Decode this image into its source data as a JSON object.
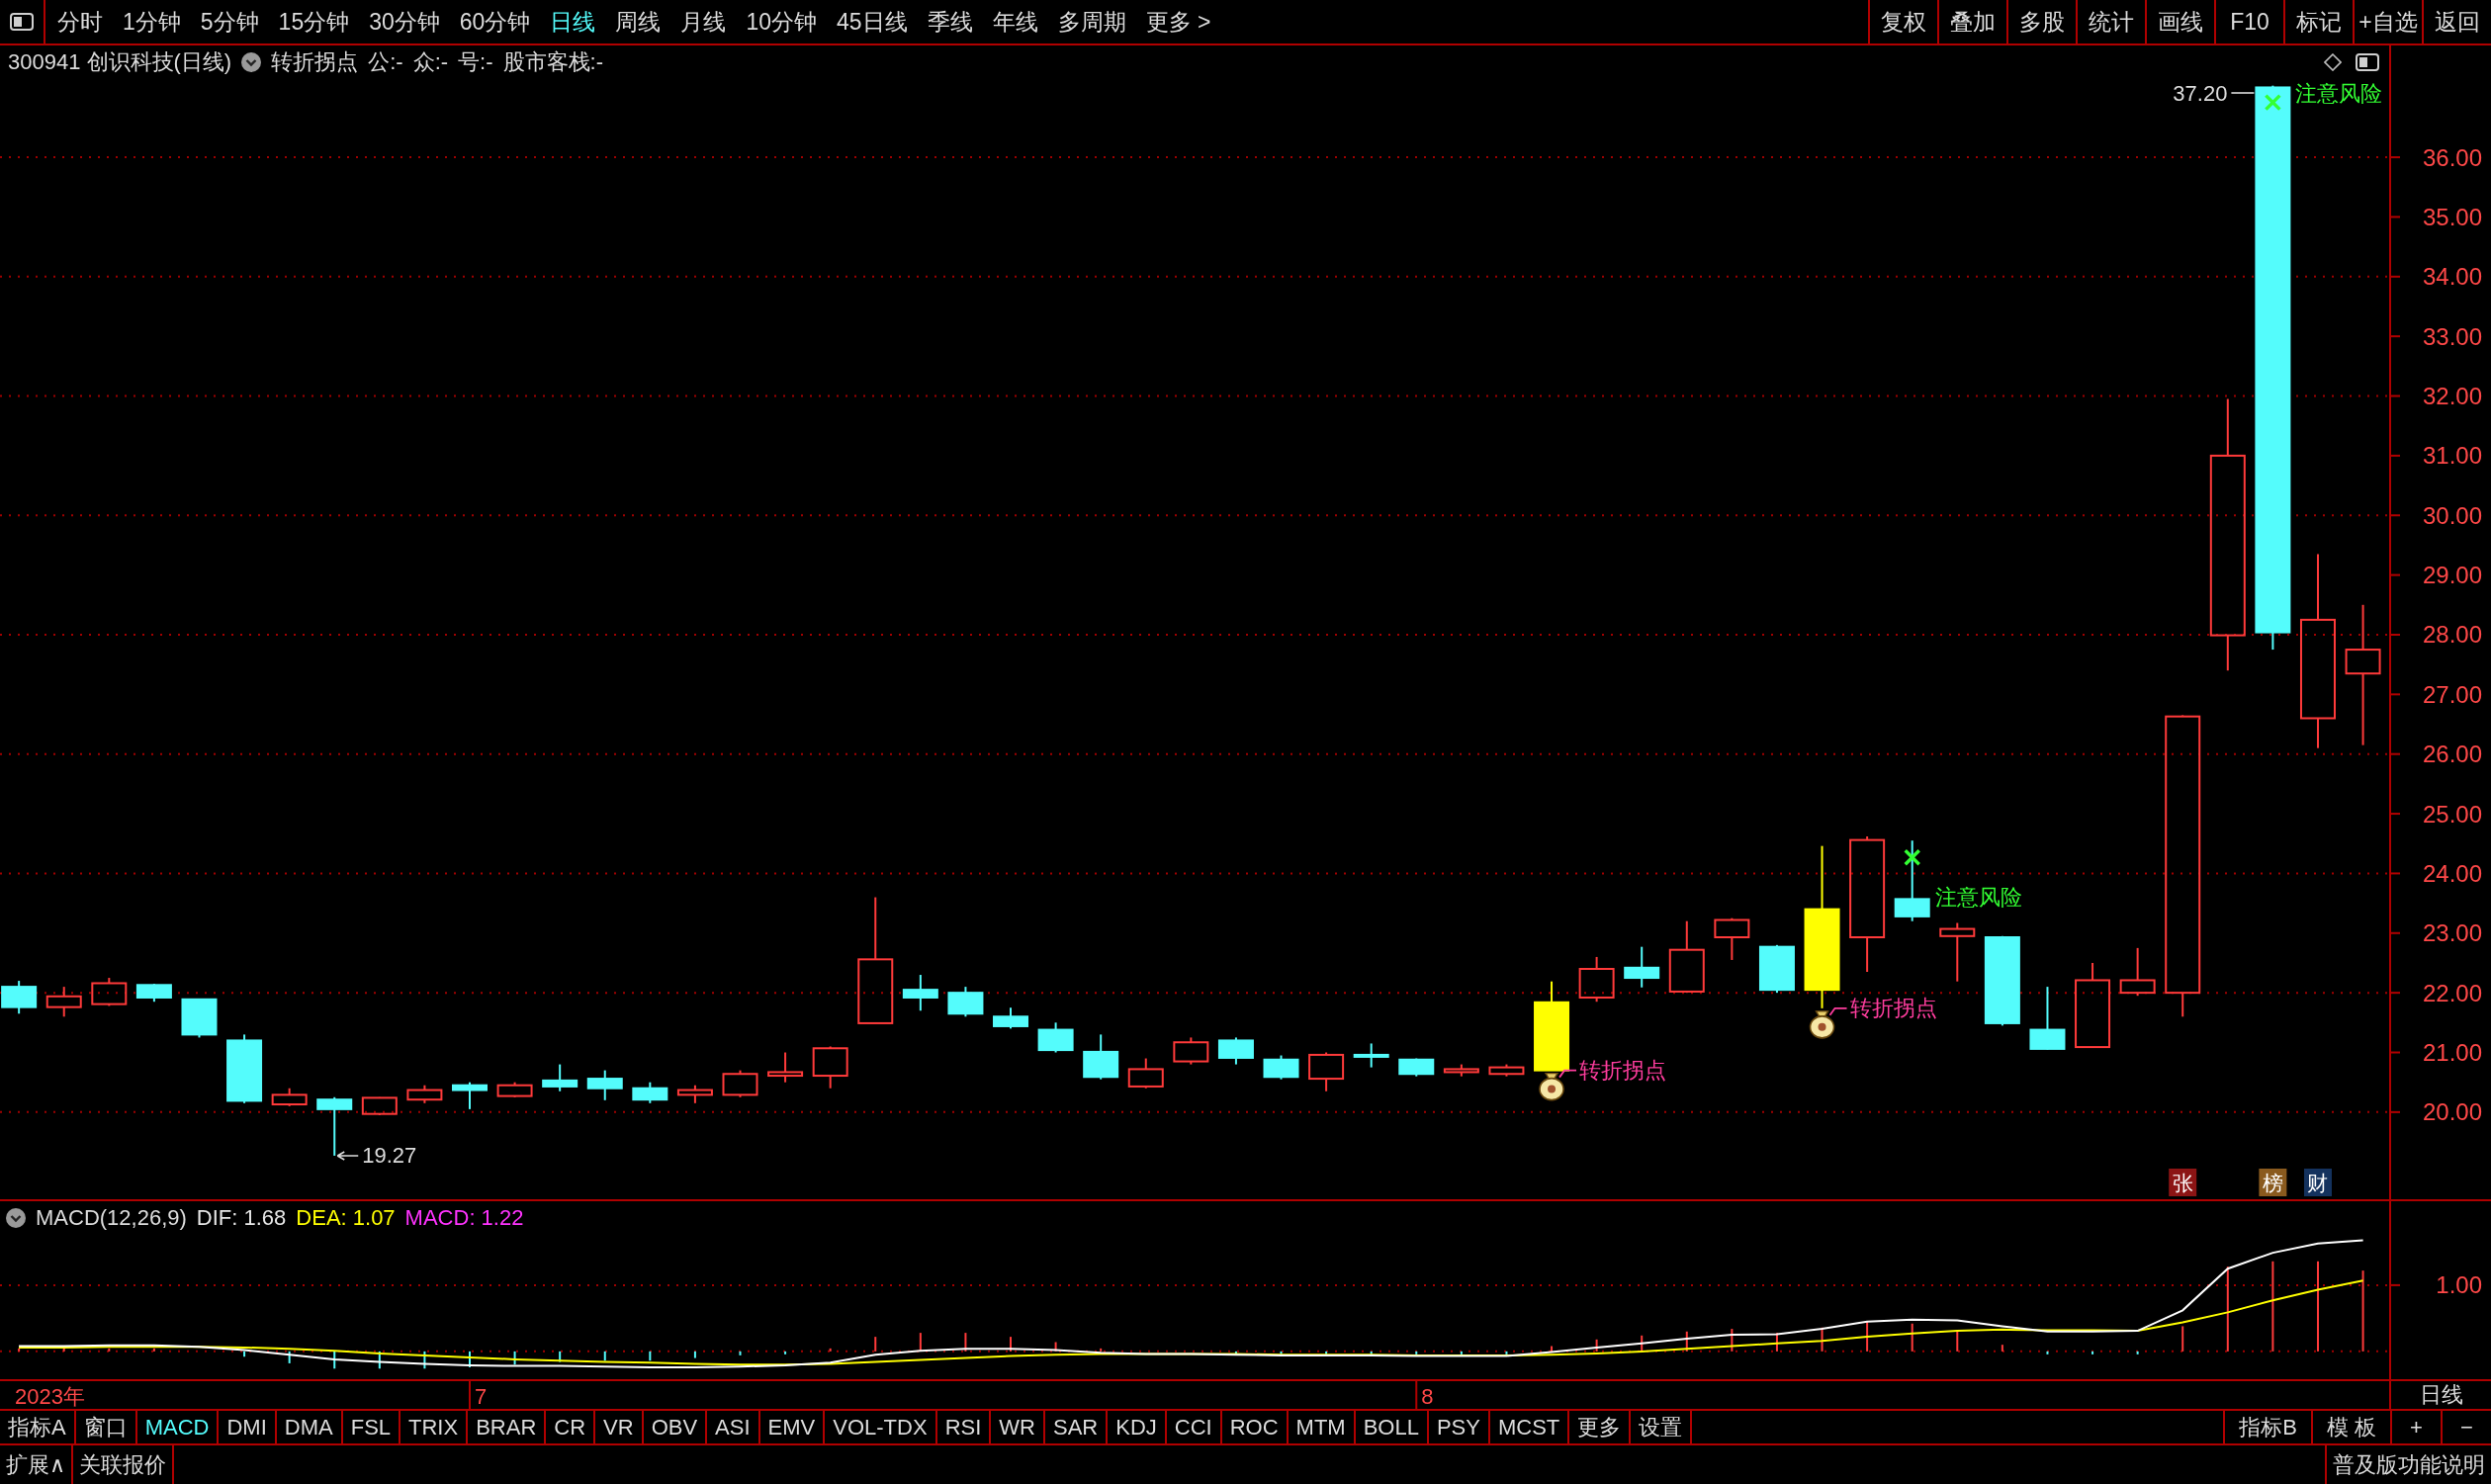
{
  "toolbar": {
    "periods": [
      {
        "label": "分时",
        "selected": false
      },
      {
        "label": "1分钟",
        "selected": false
      },
      {
        "label": "5分钟",
        "selected": false
      },
      {
        "label": "15分钟",
        "selected": false
      },
      {
        "label": "30分钟",
        "selected": false
      },
      {
        "label": "60分钟",
        "selected": false
      },
      {
        "label": "日线",
        "selected": true
      },
      {
        "label": "周线",
        "selected": false
      },
      {
        "label": "月线",
        "selected": false
      },
      {
        "label": "10分钟",
        "selected": false
      },
      {
        "label": "45日线",
        "selected": false
      },
      {
        "label": "季线",
        "selected": false
      },
      {
        "label": "年线",
        "selected": false
      },
      {
        "label": "多周期",
        "selected": false
      },
      {
        "label": "更多 >",
        "selected": false
      }
    ],
    "buttons": [
      "复权",
      "叠加",
      "多股",
      "统计",
      "画线",
      "F10",
      "标记",
      "+自选",
      "返回"
    ]
  },
  "chart_header": {
    "security": "300941 创识科技(日线)",
    "indicator": "转折拐点",
    "outputs": [
      "公:-",
      "众:-",
      "号:-",
      "股市客栈:-"
    ]
  },
  "price_chart": {
    "high_label": "37.20",
    "axis_labels": [
      "36.00",
      "35.00",
      "34.00",
      "33.00",
      "32.00",
      "31.00",
      "30.00",
      "29.00",
      "28.00",
      "27.00",
      "26.00",
      "25.00",
      "24.00",
      "23.00",
      "22.00",
      "21.00",
      "20.00"
    ],
    "warnings": [
      "注意风险",
      "注意风险"
    ],
    "signals": [
      "转折拐点",
      "转折拐点"
    ],
    "low_label": "19.27",
    "tags": [
      {
        "label": "张",
        "color": "#8c1414"
      },
      {
        "label": "榜",
        "color": "#8a5a1e"
      },
      {
        "label": "财",
        "color": "#14325e"
      }
    ]
  },
  "macd_panel": {
    "title": "MACD(12,26,9)",
    "readings": [
      {
        "text": "DIF: 1.68",
        "color": "#e6e6e6"
      },
      {
        "text": "DEA: 1.07",
        "color": "#ffff00"
      },
      {
        "text": "MACD: 1.22",
        "color": "#ff33ff"
      }
    ],
    "axis_label": "1.00"
  },
  "date_labels": [
    "2023年",
    "7",
    "8"
  ],
  "period_label": "日线",
  "indicator_tabs": [
    {
      "label": "指标A",
      "selected": false
    },
    {
      "label": "窗口",
      "selected": false
    },
    {
      "label": "MACD",
      "selected": true
    },
    {
      "label": "DMI",
      "selected": false
    },
    {
      "label": "DMA",
      "selected": false
    },
    {
      "label": "FSL",
      "selected": false
    },
    {
      "label": "TRIX",
      "selected": false
    },
    {
      "label": "BRAR",
      "selected": false
    },
    {
      "label": "CR",
      "selected": false
    },
    {
      "label": "VR",
      "selected": false
    },
    {
      "label": "OBV",
      "selected": false
    },
    {
      "label": "ASI",
      "selected": false
    },
    {
      "label": "EMV",
      "selected": false
    },
    {
      "label": "VOL-TDX",
      "selected": false
    },
    {
      "label": "RSI",
      "selected": false
    },
    {
      "label": "WR",
      "selected": false
    },
    {
      "label": "SAR",
      "selected": false
    },
    {
      "label": "KDJ",
      "selected": false
    },
    {
      "label": "CCI",
      "selected": false
    },
    {
      "label": "ROC",
      "selected": false
    },
    {
      "label": "MTM",
      "selected": false
    },
    {
      "label": "BOLL",
      "selected": false
    },
    {
      "label": "PSY",
      "selected": false
    },
    {
      "label": "MCST",
      "selected": false
    },
    {
      "label": "更多",
      "selected": false
    },
    {
      "label": "设置",
      "selected": false
    }
  ],
  "right_tabs": [
    "指标B",
    "模 板",
    "+",
    "−"
  ],
  "bottom_bar": {
    "left": [
      "扩展∧",
      "关联报价"
    ],
    "right": "普及版功能说明"
  }
}
